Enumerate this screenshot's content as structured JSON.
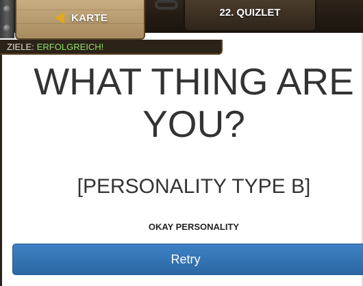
{
  "header": {
    "map_label": "KARTE",
    "level_title": "22. QUIZLET",
    "goals_label": "ZIELE:",
    "goals_status": "ERFOLGREICH!",
    "icons": {
      "back": "arrow-left-icon"
    }
  },
  "result": {
    "headline": "WHAT THING ARE YOU?",
    "type": "[PERSONALITY TYPE B]",
    "description": "OKAY PERSONALITY"
  },
  "actions": {
    "retry_label": "Retry"
  },
  "colors": {
    "accent_arrow": "#e2a81c",
    "success_text": "#8fe06a",
    "button_blue": "#2f6fae",
    "wood_light": "#c9ad82",
    "wood_dark": "#3a2e22"
  }
}
